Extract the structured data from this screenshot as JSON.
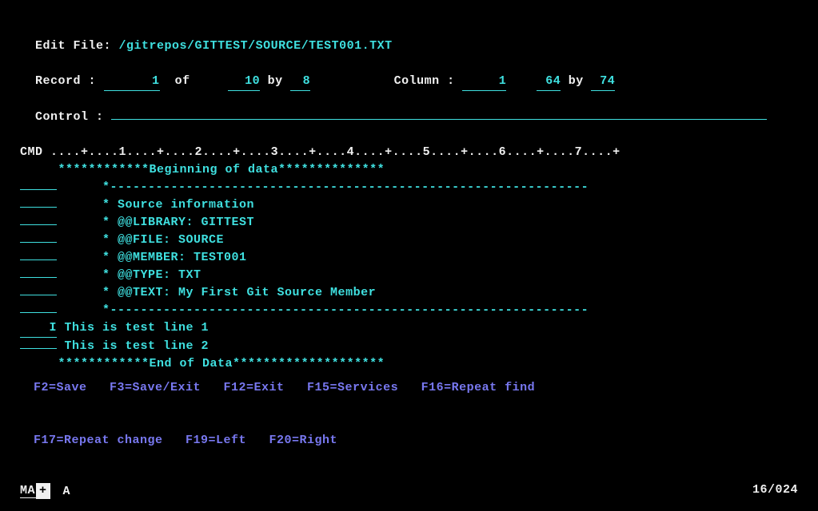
{
  "header": {
    "edit_file_label": "Edit File:",
    "file_path": "/gitrepos/GITTEST/SOURCE/TEST001.TXT",
    "record_label": "Record :",
    "record_value": "1",
    "of_label": "of",
    "of_value": "10",
    "by_label": "by",
    "by_value": "8",
    "column_label": "Column :",
    "column_value": "1",
    "column_range_from": "64",
    "column_by_label": "by",
    "column_range_to": "74",
    "control_label": "Control :"
  },
  "ruler": {
    "cmd_label": "CMD",
    "ruler_text": "....+....1....+....2....+....3....+....4....+....5....+....6....+....7....+"
  },
  "beginning_marker": "************Beginning of data**************",
  "end_marker": "************End of Data********************",
  "lines": [
    {
      "prefix": "",
      "text": "*---------------------------------------------------------------"
    },
    {
      "prefix": "",
      "text": "* Source information"
    },
    {
      "prefix": "",
      "text": "* @@LIBRARY: GITTEST"
    },
    {
      "prefix": "",
      "text": "* @@FILE: SOURCE"
    },
    {
      "prefix": "",
      "text": "* @@MEMBER: TEST001"
    },
    {
      "prefix": "",
      "text": "* @@TYPE: TXT"
    },
    {
      "prefix": "",
      "text": "* @@TEXT: My First Git Source Member"
    },
    {
      "prefix": "",
      "text": "*---------------------------------------------------------------"
    },
    {
      "prefix": "I",
      "text": "This is test line 1"
    },
    {
      "prefix": "",
      "text": "This is test line 2"
    }
  ],
  "fkeys": {
    "line1": "F2=Save   F3=Save/Exit   F12=Exit   F15=Services   F16=Repeat find",
    "line2": "F17=Repeat change   F19=Left   F20=Right"
  },
  "status": {
    "ma": "MA",
    "plus": "+",
    "a": "A",
    "pos": "16/024"
  }
}
